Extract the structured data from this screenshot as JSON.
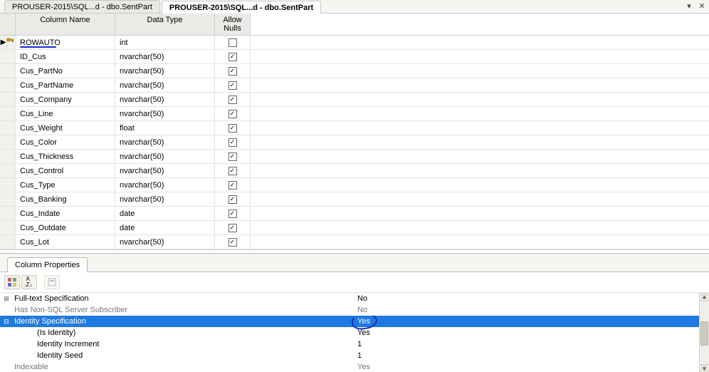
{
  "tabs": [
    {
      "label": "PROUSER-2015\\SQL...d - dbo.SentPart"
    },
    {
      "label": "PROUSER-2015\\SQL...d - dbo.SentPart"
    }
  ],
  "grid_headers": {
    "col1": "Column Name",
    "col2": "Data Type",
    "col3": "Allow Nulls"
  },
  "columns": [
    {
      "name": "ROWAUTO",
      "type": "int",
      "nullable": false,
      "pk": true,
      "selected": true
    },
    {
      "name": "ID_Cus",
      "type": "nvarchar(50)",
      "nullable": true
    },
    {
      "name": "Cus_PartNo",
      "type": "nvarchar(50)",
      "nullable": true
    },
    {
      "name": "Cus_PartName",
      "type": "nvarchar(50)",
      "nullable": true
    },
    {
      "name": "Cus_Company",
      "type": "nvarchar(50)",
      "nullable": true
    },
    {
      "name": "Cus_Line",
      "type": "nvarchar(50)",
      "nullable": true
    },
    {
      "name": "Cus_Weight",
      "type": "float",
      "nullable": true
    },
    {
      "name": "Cus_Color",
      "type": "nvarchar(50)",
      "nullable": true
    },
    {
      "name": "Cus_Thickness",
      "type": "nvarchar(50)",
      "nullable": true
    },
    {
      "name": "Cus_Control",
      "type": "nvarchar(50)",
      "nullable": true
    },
    {
      "name": "Cus_Type",
      "type": "nvarchar(50)",
      "nullable": true
    },
    {
      "name": "Cus_Banking",
      "type": "nvarchar(50)",
      "nullable": true
    },
    {
      "name": "Cus_Indate",
      "type": "date",
      "nullable": true
    },
    {
      "name": "Cus_Outdate",
      "type": "date",
      "nullable": true
    },
    {
      "name": "Cus_Lot",
      "type": "nvarchar(50)",
      "nullable": true
    }
  ],
  "props_panel": {
    "title": "Column Properties",
    "rows": [
      {
        "expander": "⊞",
        "label": "Full-text Specification",
        "value": "No"
      },
      {
        "label": "Has Non-SQL Server Subscriber",
        "value": "No",
        "disabled": true
      },
      {
        "expander": "⊟",
        "label": "Identity Specification",
        "value": "Yes",
        "selected": true,
        "circle": true
      },
      {
        "label": "(Is Identity)",
        "value": "Yes",
        "indent": 2
      },
      {
        "label": "Identity Increment",
        "value": "1",
        "indent": 2
      },
      {
        "label": "Identity Seed",
        "value": "1",
        "indent": 2
      },
      {
        "label": "Indexable",
        "value": "Yes",
        "disabled": true
      }
    ]
  }
}
